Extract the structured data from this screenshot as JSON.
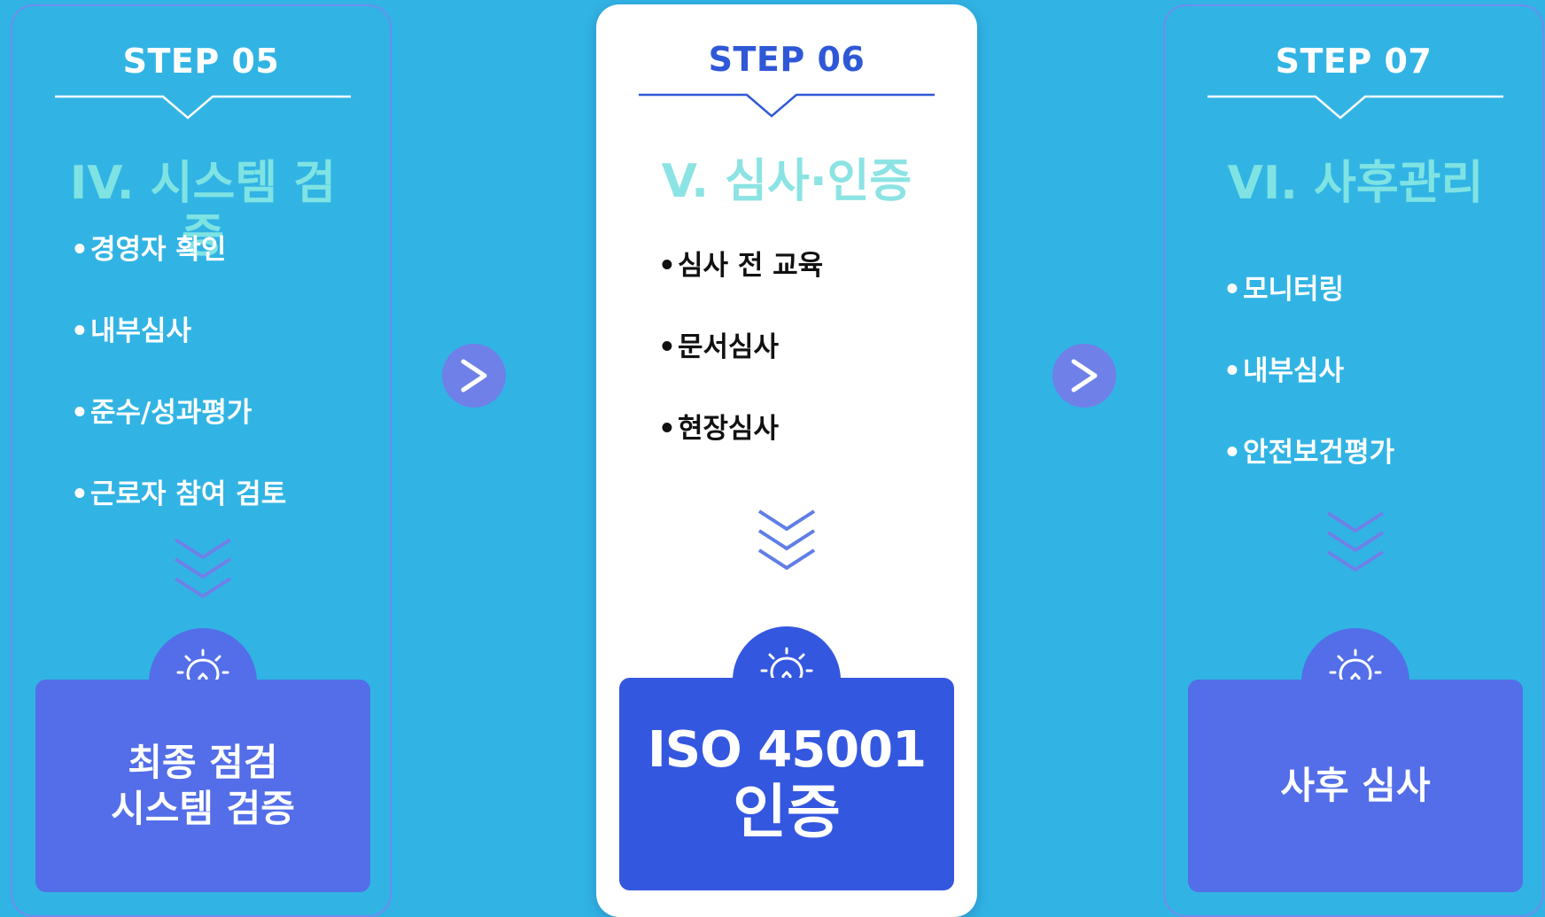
{
  "steps": [
    {
      "label": "STEP 05",
      "phase": "IV. 시스템 검증",
      "items": [
        "경영자 확인",
        "내부심사",
        "준수/성과평가",
        "근로자 참여 검토"
      ],
      "result_line1": "최종 점검",
      "result_line2": "시스템 검증"
    },
    {
      "label": "STEP 06",
      "phase": "V. 심사·인증",
      "items": [
        "심사 전 교육",
        "문서심사",
        "현장심사"
      ],
      "result_line1": "ISO 45001",
      "result_line2": "인증"
    },
    {
      "label": "STEP 07",
      "phase": "VI. 사후관리",
      "items": [
        "모니터링",
        "내부심사",
        "안전보건평가"
      ],
      "result_line1": "사후 심사"
    }
  ],
  "bullet": "•",
  "colors": {
    "background": "#31b4e4",
    "accent_blue": "#2f58d6",
    "phase_cyan": "#7fe3e3",
    "side_box": "#536ee8",
    "center_box": "#3457e0",
    "arrow_button": "#6f80e8"
  },
  "icons": {
    "divider": "notch-divider",
    "next": "chevron-right-icon",
    "down": "double-chevron-down-icon",
    "idea": "lightbulb-icon"
  }
}
